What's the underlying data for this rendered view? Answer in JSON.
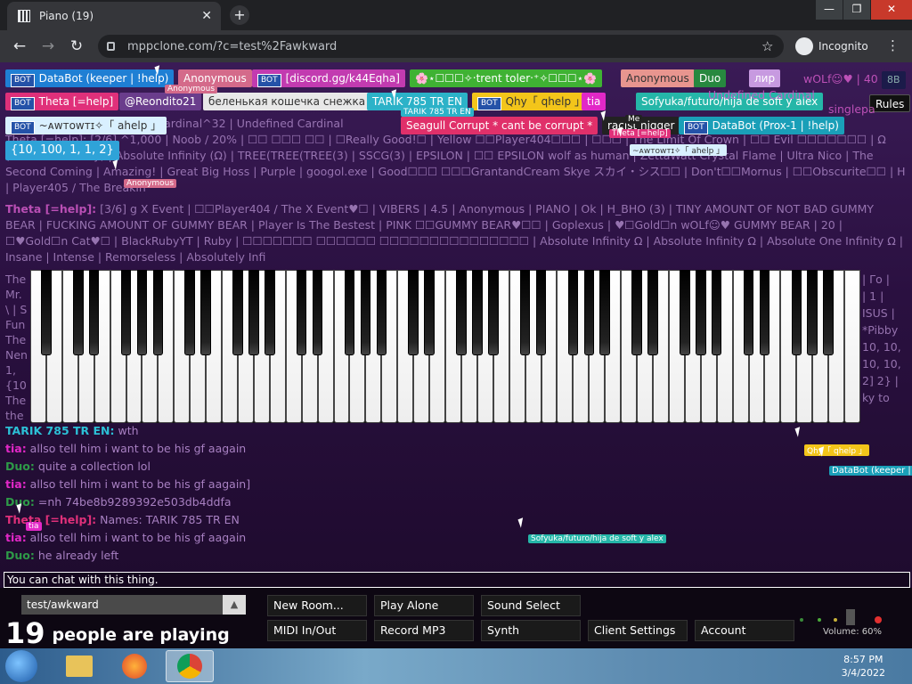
{
  "browser": {
    "tab_title": "Piano (19)",
    "tab_close": "✕",
    "new_tab": "+",
    "window_buttons": [
      "—",
      "❐",
      "✕"
    ],
    "back": "←",
    "forward": "→",
    "reload": "↻",
    "url": "mppclone.com/?c=test%2Fawkward",
    "star": "☆",
    "incognito": "Incognito",
    "menu": "⋮"
  },
  "users": {
    "bot_badge": "BOT",
    "row1": [
      {
        "name": "DataBot (keeper | !help)",
        "bot": true,
        "color": "#1f7fd4"
      },
      {
        "name": "Anonymous",
        "bot": false,
        "color": "#d46a8a"
      },
      {
        "name": "[discord.gg/k44Eqha]",
        "bot": true,
        "color": "#c23bb0"
      },
      {
        "name": "🌸⋆☐☐☐✧‧trent toler‧⁺✧☐☐☐⋆🌸",
        "bot": false,
        "color": "#3fb233"
      },
      {
        "name": "Anonymous",
        "bot": false,
        "color": "#e8958f"
      },
      {
        "name": "Duo",
        "bot": false,
        "color": "#27883f"
      },
      {
        "name": "лир",
        "bot": false,
        "color": "#c79ae0"
      }
    ],
    "row2": [
      {
        "name": "Theta [=help]",
        "bot": true,
        "color": "#e0307a"
      },
      {
        "name": "@Reondito21",
        "bot": false,
        "color": "#6a3d8c"
      },
      {
        "name": "беленькая кошечка снежка",
        "bot": false,
        "color": "#e8e8e8"
      },
      {
        "name": "TARIK 785 TR EN",
        "bot": false,
        "color": "#2cb2c8"
      },
      {
        "name": "Qhy「 qhelp 」",
        "bot": true,
        "color": "#f3c51a"
      },
      {
        "name": "tia",
        "bot": false,
        "color": "#e228c7"
      },
      {
        "name": "Sofyuka/futuro/hija de soft y alex",
        "bot": false,
        "color": "#25b6a8"
      }
    ],
    "row3": [
      {
        "name": "~ᴀᴡᴛᴏᴡᴛɪ✧「 ahelp 」",
        "bot": true,
        "color": "#d9f0ff"
      },
      {
        "name": "Seagull Corrupt * cant be corrupt *",
        "bot": false,
        "color": "#e0306a"
      },
      {
        "name": "racist nigger",
        "bot": false,
        "color": "#222222"
      },
      {
        "name": "DataBot (Prox-1 | !help)",
        "bot": true,
        "color": "#1a9fb8"
      }
    ],
    "row4": {
      "name": "{10, 100, 1, 1, 2}",
      "color": "#2fa3d8"
    },
    "right_badge": "8B",
    "rules": "Rules",
    "right_clip": "wOLf☺♥ | 40",
    "right_clip2": "Undefined Cardinal",
    "right_clip3": "singlepa"
  },
  "floating_labels": {
    "anon1": "Anonymous",
    "tarik": "TARIK 785 TR EN",
    "me": "Me",
    "theta": "Theta [=help]",
    "awt": "~ᴀᴡᴛᴏᴡᴛɪ✧「 ahelp 」",
    "anon2": "Anonymous",
    "tia": "tia",
    "qhy": "Qhy「 qhelp 」",
    "databot": "DataBot (keeper |",
    "sofyuka": "Sofyuka/futuro/hija de soft y alex"
  },
  "background_text": {
    "p1": "fined Cardinal^32 | Undefined Cardinal",
    "p2": "Theta [=help]: [2/6] ^1,000 | Noob / 20% | ☐☐ ☐☐☐ ☐☐ | ☐Really Good!☐ | Yellow ☐☐Player404☐☐☐ | ☐☐☐ | The Limit Of Crown | ☐☐ Evil ☐☐☐☐☐☐☐ | Ω (Absolute Infinity) | Absolute Infinity (Ω) | TREE(TREE(TREE(3) | SSCG(3) | EPSILON | ☐☐ EPSILON wolf as human | ZettaWatt Crystal Flame | Ultra Nico | The Second Coming | Amazing! | Great Big Hoss | Purple | googol.exe | Good☐☐☐ ☐☐☐GrantandCream Skye スカイ・シス☐☐ | Don't☐☐Mornus | ☐☐Obscurite☐☐ | H | Player405 / The Breakin",
    "p3_name": "Theta [=help]:",
    "p3": " [3/6] g X Event | ☐☐Player404 / The X Event♥☐ | VIBERS | 4.5 | Anonymous | PIANO | Ok | H_BHO (3) | TINY AMOUNT OF NOT BAD GUMMY BEAR | FUCKING AMOUNT OF GUMMY BEAR | Player Is The Bestest | PINK ☐☐GUMMY BEAR♥☐☐ | Goplexus | ♥☐Gold☐n wOLf☺♥ GUMMY BEAR | 20 | ☐♥Gold☐n Cat♥☐ | BlackRubyYT | Ruby | ☐☐☐☐☐☐☐ ☐☐☐☐☐☐ ☐☐☐☐☐☐☐☐☐☐☐☐☐☐☐ | Absolute Infinity Ω | Absolute Infinity Ω | Absolute One Infinity Ω | Insane | Intense | Remorseless | Absolutely Infi",
    "left_frag": [
      "The",
      "Mr.",
      "\\ | S",
      "Fun",
      "The",
      "Nen",
      "1, ",
      "{10",
      "The",
      "the"
    ],
    "right_frag": [
      "| Γo |",
      "| 1 |",
      "ISUS |",
      "*Pibby",
      "10, 10,",
      "10, 10,",
      "2] 2} |",
      "ky to"
    ]
  },
  "chat": [
    {
      "name": "TARIK 785 TR EN:",
      "text": "wth",
      "color": "#2cc0d6"
    },
    {
      "name": "tia:",
      "text": "allso tell him i want to be his gf aagain",
      "color": "#e228c7"
    },
    {
      "name": "Duo:",
      "text": "quite a collection lol",
      "color": "#2e9a48"
    },
    {
      "name": "tia:",
      "text": "allso tell him i want to be his gf aagain]",
      "color": "#e228c7"
    },
    {
      "name": "Duo:",
      "text": "=nh 74be8b9289392e503db4ddfa",
      "color": "#2e9a48"
    },
    {
      "name": "Theta [=help]:",
      "text": "Names: TARIK 785 TR EN",
      "color": "#e0307a"
    },
    {
      "name": "tia:",
      "text": "allso tell him i want to be his gf aagain",
      "color": "#e228c7"
    },
    {
      "name": "Duo:",
      "text": "he already left",
      "color": "#2e9a48"
    }
  ],
  "chat_input_placeholder": "You can chat with this thing.",
  "bottom": {
    "room": "test/awkward",
    "room_arrow": "▲",
    "count_number": "19",
    "count_text": "people are playing",
    "buttons_row1": [
      "New Room...",
      "Play Alone",
      "Sound Select"
    ],
    "buttons_row2": [
      "MIDI In/Out",
      "Record MP3",
      "Synth",
      "Client Settings",
      "Account"
    ],
    "volume_label": "Volume: 60%",
    "volume_level": 0.6
  },
  "taskbar": {
    "time": "8:57 PM",
    "date": "3/4/2022"
  }
}
